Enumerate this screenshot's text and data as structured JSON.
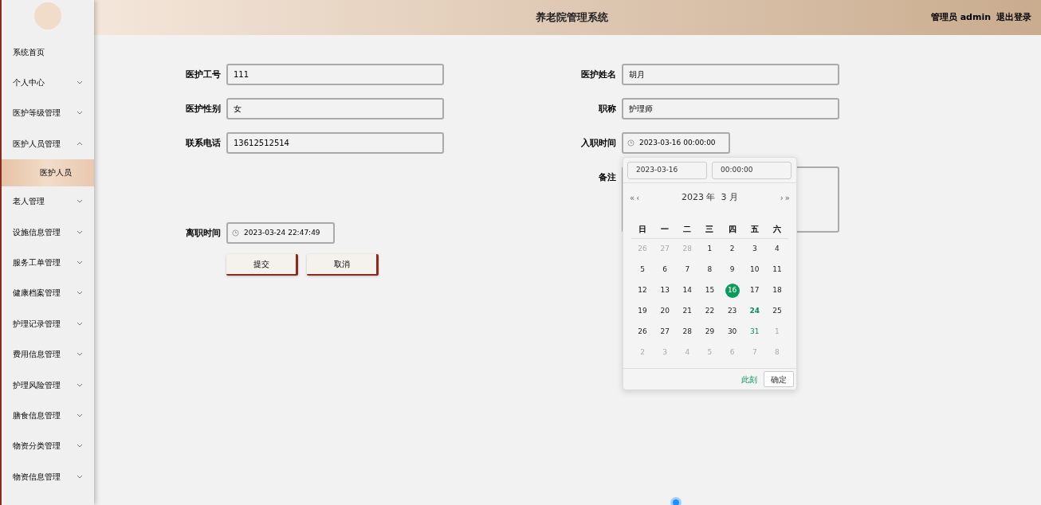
{
  "header": {
    "title": "养老院管理系统",
    "user": "管理员 admin",
    "logout": "退出登录"
  },
  "sidebar": {
    "items": [
      {
        "label": "系统首页"
      },
      {
        "label": "个人中心",
        "expandable": true,
        "expanded": false
      },
      {
        "label": "医护等级管理",
        "expandable": true,
        "expanded": false
      },
      {
        "label": "医护人员管理",
        "expandable": true,
        "expanded": true,
        "children": [
          {
            "label": "医护人员",
            "selected": true
          }
        ]
      },
      {
        "label": "老人管理",
        "expandable": true,
        "expanded": false
      },
      {
        "label": "设施信息管理",
        "expandable": true,
        "expanded": false
      },
      {
        "label": "服务工单管理",
        "expandable": true,
        "expanded": false
      },
      {
        "label": "健康档案管理",
        "expandable": true,
        "expanded": false
      },
      {
        "label": "护理记录管理",
        "expandable": true,
        "expanded": false
      },
      {
        "label": "费用信息管理",
        "expandable": true,
        "expanded": false
      },
      {
        "label": "护理风险管理",
        "expandable": true,
        "expanded": false
      },
      {
        "label": "膳食信息管理",
        "expandable": true,
        "expanded": false
      },
      {
        "label": "物资分类管理",
        "expandable": true,
        "expanded": false
      },
      {
        "label": "物资信息管理",
        "expandable": true,
        "expanded": false
      }
    ]
  },
  "form": {
    "left": [
      {
        "kind": "text",
        "label": "医护工号",
        "value": "111"
      },
      {
        "kind": "text",
        "label": "医护性别",
        "value": "女"
      },
      {
        "kind": "text",
        "label": "联系电话",
        "value": "13612512514"
      },
      {
        "kind": "spacer"
      },
      {
        "kind": "datetime",
        "label": "离职时间",
        "value": "2023-03-24 22:47:49"
      }
    ],
    "right": [
      {
        "kind": "text",
        "label": "医护姓名",
        "value": "胡月"
      },
      {
        "kind": "text",
        "label": "职称",
        "value": "护理师"
      },
      {
        "kind": "datetime",
        "label": "入职时间",
        "value": "2023-03-16 00:00:00"
      },
      {
        "kind": "textarea",
        "label": "备注"
      }
    ],
    "buttons": [
      {
        "label": "提交"
      },
      {
        "label": "取消"
      }
    ]
  },
  "date_picker": {
    "date": "2023-03-16",
    "time": "00:00:00",
    "month_label": "2023 年  3 月",
    "prev_year": "«",
    "prev_month": "‹",
    "next_month": "›",
    "next_year": "»",
    "weekdays": [
      "日",
      "一",
      "二",
      "三",
      "四",
      "五",
      "六"
    ],
    "weeks": [
      [
        {
          "day": "26",
          "kind": "other",
          "selected": false
        },
        {
          "day": "27",
          "kind": "other",
          "selected": false
        },
        {
          "day": "28",
          "kind": "other",
          "selected": false
        },
        {
          "day": "1",
          "kind": "current",
          "selected": false
        },
        {
          "day": "2",
          "kind": "current",
          "selected": false
        },
        {
          "day": "3",
          "kind": "current",
          "selected": false
        },
        {
          "day": "4",
          "kind": "current",
          "selected": false
        }
      ],
      [
        {
          "day": "5",
          "kind": "current",
          "selected": false
        },
        {
          "day": "6",
          "kind": "current",
          "selected": false
        },
        {
          "day": "7",
          "kind": "current",
          "selected": false
        },
        {
          "day": "8",
          "kind": "current",
          "selected": false
        },
        {
          "day": "9",
          "kind": "current",
          "selected": false
        },
        {
          "day": "10",
          "kind": "current",
          "selected": false
        },
        {
          "day": "11",
          "kind": "current",
          "selected": false
        }
      ],
      [
        {
          "day": "12",
          "kind": "current",
          "selected": false
        },
        {
          "day": "13",
          "kind": "current",
          "selected": false
        },
        {
          "day": "14",
          "kind": "current",
          "selected": false
        },
        {
          "day": "15",
          "kind": "current",
          "selected": false
        },
        {
          "day": "16",
          "kind": "current",
          "selected": true
        },
        {
          "day": "17",
          "kind": "current",
          "selected": false
        },
        {
          "day": "18",
          "kind": "current",
          "selected": false
        }
      ],
      [
        {
          "day": "19",
          "kind": "current",
          "selected": false
        },
        {
          "day": "20",
          "kind": "current",
          "selected": false
        },
        {
          "day": "21",
          "kind": "current",
          "selected": false
        },
        {
          "day": "22",
          "kind": "current",
          "selected": false
        },
        {
          "day": "23",
          "kind": "current",
          "selected": false
        },
        {
          "day": "24",
          "kind": "today",
          "selected": false
        },
        {
          "day": "25",
          "kind": "current",
          "selected": false
        }
      ],
      [
        {
          "day": "26",
          "kind": "current",
          "selected": false
        },
        {
          "day": "27",
          "kind": "current",
          "selected": false
        },
        {
          "day": "28",
          "kind": "current",
          "selected": false
        },
        {
          "day": "29",
          "kind": "current",
          "selected": false
        },
        {
          "day": "30",
          "kind": "current",
          "selected": false
        },
        {
          "day": "31",
          "kind": "hover",
          "selected": false
        },
        {
          "day": "1",
          "kind": "other",
          "selected": false
        }
      ],
      [
        {
          "day": "2",
          "kind": "other",
          "selected": false
        },
        {
          "day": "3",
          "kind": "other",
          "selected": false
        },
        {
          "day": "4",
          "kind": "other",
          "selected": false
        },
        {
          "day": "5",
          "kind": "other",
          "selected": false
        },
        {
          "day": "6",
          "kind": "other",
          "selected": false
        },
        {
          "day": "7",
          "kind": "other",
          "selected": false
        },
        {
          "day": "8",
          "kind": "other",
          "selected": false
        }
      ]
    ],
    "now": "此刻",
    "confirm": "确定"
  }
}
